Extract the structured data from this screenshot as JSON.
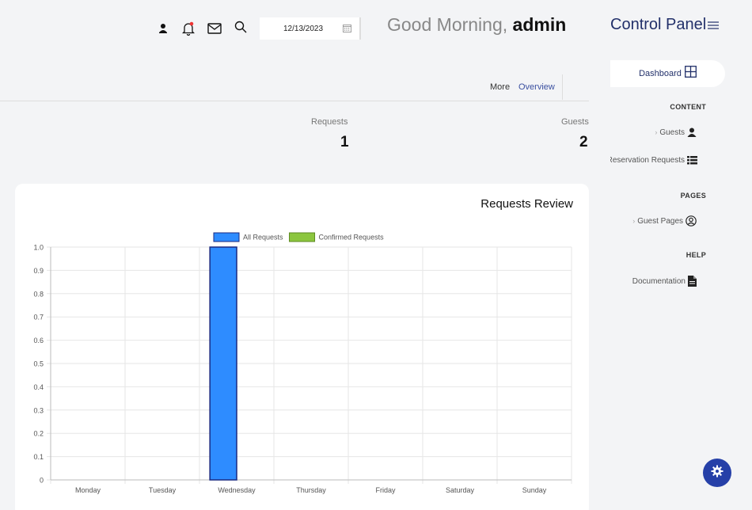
{
  "header": {
    "date_value": "12/13/2023",
    "greeting_prefix": "Good Morning, ",
    "greeting_user": "admin",
    "icons": [
      "user-icon",
      "bell-icon",
      "mail-icon",
      "search-icon",
      "calendar-icon"
    ]
  },
  "subnav": {
    "more_label": "More",
    "overview_label": "Overview"
  },
  "stats": [
    {
      "label": "Requests",
      "value": "1"
    },
    {
      "label": "Guests",
      "value": "2"
    }
  ],
  "chart_card": {
    "title": "Requests Review"
  },
  "chart_data": {
    "type": "bar",
    "categories": [
      "Monday",
      "Tuesday",
      "Wednesday",
      "Thursday",
      "Friday",
      "Saturday",
      "Sunday"
    ],
    "series": [
      {
        "name": "All Requests",
        "values": [
          0,
          0,
          1,
          0,
          0,
          0,
          0
        ],
        "color": "#2e8cff",
        "border": "#1a2a80"
      },
      {
        "name": "Confirmed Requests",
        "values": [
          0,
          0,
          0,
          0,
          0,
          0,
          0
        ],
        "color": "#8cc63f",
        "border": "#5d8a20"
      }
    ],
    "ylim": [
      0,
      1.0
    ],
    "yticks": [
      "0",
      "0.1",
      "0.2",
      "0.3",
      "0.4",
      "0.5",
      "0.6",
      "0.7",
      "0.8",
      "0.9",
      "1.0"
    ],
    "grid": true,
    "legend": "top-center"
  },
  "sidebar": {
    "title": "Control Panel",
    "active_item": "Dashboard",
    "sections": {
      "content": "CONTENT",
      "pages": "PAGES",
      "help": "HELP"
    },
    "items": {
      "guests": "Guests",
      "reservation_requests": "Reservation Requests",
      "guest_pages": "Guest Pages",
      "documentation": "Documentation"
    }
  },
  "colors": {
    "accent": "#22306a",
    "fab": "#2640a8",
    "link": "#3a4fa0"
  }
}
